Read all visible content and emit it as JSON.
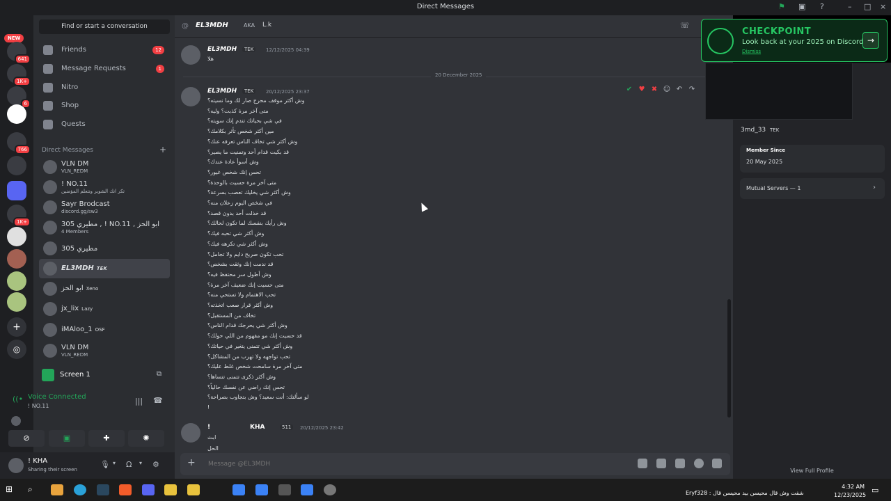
{
  "window": {
    "title": "Direct Messages"
  },
  "servers": {
    "new_label": "NEW",
    "badges": [
      "641",
      "1K+",
      "6",
      "",
      "766",
      "1K+"
    ]
  },
  "sidebar": {
    "search_label": "Find or start a conversation",
    "nav": [
      {
        "label": "Friends",
        "count": "12"
      },
      {
        "label": "Message Requests",
        "count": "1"
      },
      {
        "label": "Nitro",
        "count": ""
      },
      {
        "label": "Shop",
        "count": ""
      },
      {
        "label": "Quests",
        "count": ""
      }
    ],
    "dm_header": "Direct Messages",
    "dms": [
      {
        "name": "VLN DM",
        "sub": "VLN_REDM",
        "tag": ""
      },
      {
        "name": "! NO.11",
        "sub": "تكر انك الشوير ونتعلم المؤمنين",
        "tag": ""
      },
      {
        "name": "Sayr Brodcast",
        "sub": "discord.gg/sw3",
        "tag": ""
      },
      {
        "name": "مطيري 305 , ! NO.11 , ابو الحز",
        "sub": "4 Members",
        "tag": ""
      },
      {
        "name": "305 مطيري",
        "sub": "",
        "tag": ""
      },
      {
        "name": "EL3MDH",
        "sub": "",
        "tag": "TEK"
      },
      {
        "name": "ابو الحز",
        "sub": "",
        "tag": "Xeno"
      },
      {
        "name": "jx_lix",
        "sub": "",
        "tag": "Lazy"
      },
      {
        "name": "iMAloo_1",
        "sub": "",
        "tag": "OSF"
      },
      {
        "name": "VLN DM",
        "sub": "VLN_REDM",
        "tag": ""
      }
    ],
    "screen_label": "Screen 1",
    "voice": {
      "status": "Voice Connected",
      "channel": "! NO.11"
    },
    "user": {
      "name": "! KHA",
      "status": "Sharing their screen"
    }
  },
  "chat": {
    "header": {
      "name": "EL3MDH",
      "aka_label": "AKA",
      "aka_value": "L.k"
    },
    "msg1": {
      "author": "EL3MDH",
      "tag": "TEK",
      "time": "12/12/2025 04:39",
      "text": "هلا"
    },
    "date_divider": "20 December 2025",
    "msg2": {
      "author": "EL3MDH",
      "tag": "TEK",
      "time": "20/12/2025 23:37",
      "lines": [
        "وش أكثر موقف محرج صار لك وما نسيته؟",
        "متى آخر مرة كذبت؟ وليه؟",
        "في شي بحياتك تندم إنك سويته؟",
        "مين أكثر شخص تأثر بكلامك؟",
        "وش أكثر شي تخاف الناس تعرفه عنك؟",
        "قد بكيت قدام أحد وتمنيت ما يصير؟",
        "وش أسوأ عادة عندك؟",
        "تحس إنك شخص غيور؟",
        "متى آخر مرة حسيت بالوحدة؟",
        "وش أكثر شي يخليك تعصب بسرعة؟",
        "في شخص اليوم زعلان منه؟",
        "قد خذلت أحد بدون قصد؟",
        "وش رأيك بنفسك لما تكون لحالك؟",
        "وش أكثر شي تحبه فيك؟",
        "وش أكثر شي تكرهه فيك؟",
        "تحب تكون صريح دايم ولا تجامل؟",
        "قد ندمت إنك وثقت بشخص؟",
        "وش أطول سر محتفظ فيه؟",
        "متى حسيت إنك ضعيف آخر مرة؟",
        "تحب الاهتمام ولا تستحي منه؟",
        "وش أكثر قرار صعب اتخذته؟",
        "تخاف من المستقبل؟",
        "وش أكثر شي يحرجك قدام الناس؟",
        "قد حسيت إنك مو مفهوم من اللي حولك؟",
        "وش أكثر شي تتمنى يتغير في حياتك؟",
        "تحب تواجهه ولا تهرب من المشاكل؟",
        "متى آخر مرة سامحت شخص غلط عليك؟",
        "وش أكثر ذكرى تتمنى تنساها؟",
        "تحس إنك راضي عن نفسك حالياً؟",
        "لو سألتك: أنت سعيد؟ وش بتجاوب بصراحة؟",
        "!"
      ]
    },
    "msg3": {
      "author": "!",
      "author2": "KHA",
      "tag": "511",
      "time": "20/12/2025 23:42",
      "lines": [
        "ابث",
        "الحل"
      ]
    },
    "composer_placeholder": "Message @EL3MDH"
  },
  "profile": {
    "username": "3md_33",
    "tag": "TEK",
    "member_since_label": "Member Since",
    "member_since": "20 May 2025",
    "mutual_servers": "Mutual Servers — 1",
    "view_full": "View Full Profile"
  },
  "checkpoint": {
    "title": "CHECKPOINT",
    "subtitle": "Look back at your 2025 on Discord",
    "dismiss": "Dismiss"
  },
  "taskbar": {
    "ticker": "Eryf328 : شفت وش قال محيسن بيد محيسن قال",
    "time": "4:32 AM",
    "date": "12/23/2025"
  },
  "colors": {
    "accent": "#5865f2",
    "green": "#23a559",
    "red": "#f23f43",
    "checkpoint": "#26c763"
  }
}
